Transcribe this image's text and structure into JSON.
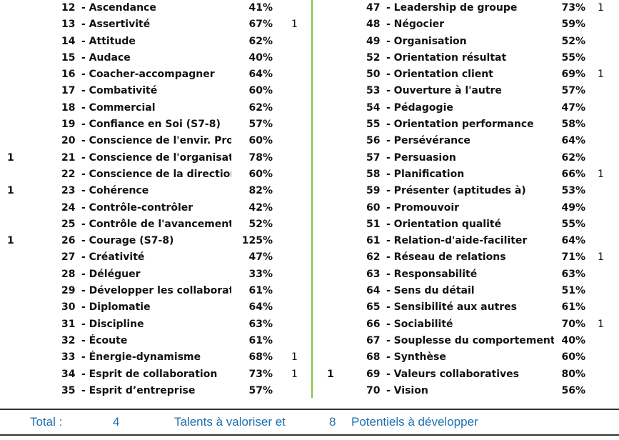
{
  "left_column": [
    {
      "left_flag": "",
      "num": "12",
      "label": "- Ascendance",
      "pct": "41%",
      "right_flag": ""
    },
    {
      "left_flag": "",
      "num": "13",
      "label": "- Assertivité",
      "pct": "67%",
      "right_flag": "1"
    },
    {
      "left_flag": "",
      "num": "14",
      "label": "- Attitude",
      "pct": "62%",
      "right_flag": ""
    },
    {
      "left_flag": "",
      "num": "15",
      "label": "- Audace",
      "pct": "40%",
      "right_flag": ""
    },
    {
      "left_flag": "",
      "num": "16",
      "label": "- Coacher-accompagner",
      "pct": "64%",
      "right_flag": ""
    },
    {
      "left_flag": "",
      "num": "17",
      "label": "- Combativité",
      "pct": "60%",
      "right_flag": ""
    },
    {
      "left_flag": "",
      "num": "18",
      "label": "- Commercial",
      "pct": "62%",
      "right_flag": ""
    },
    {
      "left_flag": "",
      "num": "19",
      "label": "- Confiance en Soi (S7-8)",
      "pct": "57%",
      "right_flag": ""
    },
    {
      "left_flag": "",
      "num": "20",
      "label": "- Conscience de l'envir. Prof",
      "pct": "60%",
      "right_flag": ""
    },
    {
      "left_flag": "1",
      "num": "21",
      "label": "- Conscience de l'organisatio",
      "pct": "78%",
      "right_flag": ""
    },
    {
      "left_flag": "",
      "num": "22",
      "label": "- Conscience de la direction",
      "pct": "60%",
      "right_flag": ""
    },
    {
      "left_flag": "1",
      "num": "23",
      "label": "- Cohérence",
      "pct": "82%",
      "right_flag": ""
    },
    {
      "left_flag": "",
      "num": "24",
      "label": "- Contrôle-contrôler",
      "pct": "42%",
      "right_flag": ""
    },
    {
      "left_flag": "",
      "num": "25",
      "label": "- Contrôle de l'avancement",
      "pct": "52%",
      "right_flag": ""
    },
    {
      "left_flag": "1",
      "num": "26",
      "label": "- Courage (S7-8)",
      "pct": "125%",
      "right_flag": ""
    },
    {
      "left_flag": "",
      "num": "27",
      "label": "- Créativité",
      "pct": "47%",
      "right_flag": ""
    },
    {
      "left_flag": "",
      "num": "28",
      "label": "- Déléguer",
      "pct": "33%",
      "right_flag": ""
    },
    {
      "left_flag": "",
      "num": "29",
      "label": "- Développer les collaborateurs",
      "pct": "61%",
      "right_flag": ""
    },
    {
      "left_flag": "",
      "num": "30",
      "label": "- Diplomatie",
      "pct": "64%",
      "right_flag": ""
    },
    {
      "left_flag": "",
      "num": "31",
      "label": "- Discipline",
      "pct": "63%",
      "right_flag": ""
    },
    {
      "left_flag": "",
      "num": "32",
      "label": "- Écoute",
      "pct": "61%",
      "right_flag": ""
    },
    {
      "left_flag": "",
      "num": "33",
      "label": "- Énergie-dynamisme",
      "pct": "68%",
      "right_flag": "1"
    },
    {
      "left_flag": "",
      "num": "34",
      "label": "- Esprit de collaboration",
      "pct": "73%",
      "right_flag": "1"
    },
    {
      "left_flag": "",
      "num": "35",
      "label": "- Esprit d’entreprise",
      "pct": "57%",
      "right_flag": ""
    }
  ],
  "right_column": [
    {
      "left_flag": "",
      "num": "47",
      "label": "- Leadership de groupe",
      "pct": "73%",
      "right_flag": "1"
    },
    {
      "left_flag": "",
      "num": "48",
      "label": "- Négocier",
      "pct": "59%",
      "right_flag": ""
    },
    {
      "left_flag": "",
      "num": "49",
      "label": "- Organisation",
      "pct": "52%",
      "right_flag": ""
    },
    {
      "left_flag": "",
      "num": "52",
      "label": "- Orientation résultat",
      "pct": "55%",
      "right_flag": ""
    },
    {
      "left_flag": "",
      "num": "50",
      "label": "- Orientation client",
      "pct": "69%",
      "right_flag": "1"
    },
    {
      "left_flag": "",
      "num": "53",
      "label": "- Ouverture à l'autre",
      "pct": "57%",
      "right_flag": ""
    },
    {
      "left_flag": "",
      "num": "54",
      "label": "- Pédagogie",
      "pct": "47%",
      "right_flag": ""
    },
    {
      "left_flag": "",
      "num": "55",
      "label": "- Orientation performance",
      "pct": "58%",
      "right_flag": ""
    },
    {
      "left_flag": "",
      "num": "56",
      "label": "- Persévérance",
      "pct": "64%",
      "right_flag": ""
    },
    {
      "left_flag": "",
      "num": "57",
      "label": "- Persuasion",
      "pct": "62%",
      "right_flag": ""
    },
    {
      "left_flag": "",
      "num": "58",
      "label": "- Planification",
      "pct": "66%",
      "right_flag": "1"
    },
    {
      "left_flag": "",
      "num": "59",
      "label": "- Présenter (aptitudes à)",
      "pct": "53%",
      "right_flag": ""
    },
    {
      "left_flag": "",
      "num": "60",
      "label": "- Promouvoir",
      "pct": "49%",
      "right_flag": ""
    },
    {
      "left_flag": "",
      "num": "51",
      "label": "- Orientation qualité",
      "pct": "55%",
      "right_flag": ""
    },
    {
      "left_flag": "",
      "num": "61",
      "label": "- Relation-d'aide-faciliter",
      "pct": "64%",
      "right_flag": ""
    },
    {
      "left_flag": "",
      "num": "62",
      "label": "- Réseau de relations",
      "pct": "71%",
      "right_flag": "1"
    },
    {
      "left_flag": "",
      "num": "63",
      "label": "- Responsabilité",
      "pct": "63%",
      "right_flag": ""
    },
    {
      "left_flag": "",
      "num": "64",
      "label": "- Sens du détail",
      "pct": "51%",
      "right_flag": ""
    },
    {
      "left_flag": "",
      "num": "65",
      "label": "- Sensibilité aux autres",
      "pct": "61%",
      "right_flag": ""
    },
    {
      "left_flag": "",
      "num": "66",
      "label": "- Sociabilité",
      "pct": "70%",
      "right_flag": "1"
    },
    {
      "left_flag": "",
      "num": "67",
      "label": "- Souplesse du comportement",
      "pct": "40%",
      "right_flag": ""
    },
    {
      "left_flag": "",
      "num": "68",
      "label": "- Synthèse",
      "pct": "60%",
      "right_flag": ""
    },
    {
      "left_flag": "1",
      "num": "69",
      "label": "- Valeurs collaboratives",
      "pct": "80%",
      "right_flag": ""
    },
    {
      "left_flag": "",
      "num": "70",
      "label": "- Vision",
      "pct": "56%",
      "right_flag": ""
    }
  ],
  "total": {
    "label": "Total :",
    "talents_count": "4",
    "talents_label": "Talents à valoriser et",
    "potentials_count": "8",
    "potentials_label": "Potentiels à développer"
  },
  "colors": {
    "divider_green": "#7dc242",
    "total_blue": "#1f6fae"
  }
}
